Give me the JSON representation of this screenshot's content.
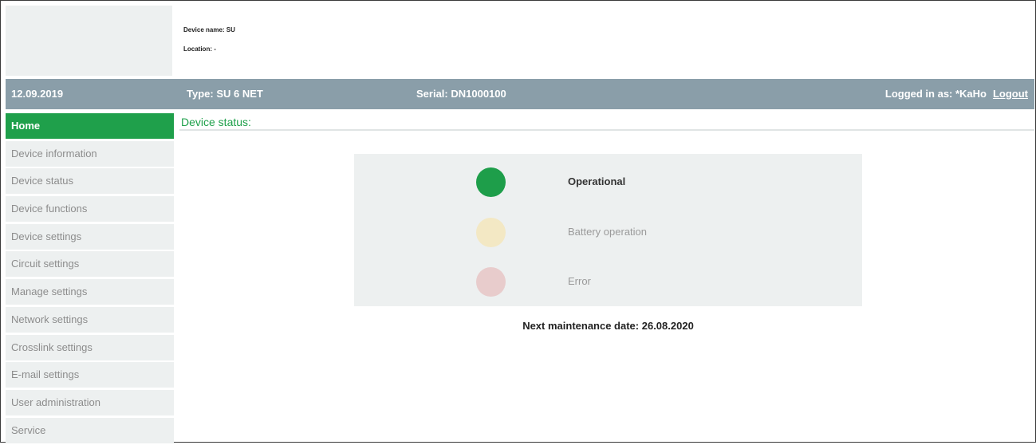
{
  "header": {
    "device_name": "Device name: SU",
    "location": "Location: -"
  },
  "topbar": {
    "date": "12.09.2019",
    "type": "Type: SU 6 NET",
    "serial": "Serial: DN1000100",
    "logged_in": "Logged in as: *KaHo",
    "logout": "Logout"
  },
  "sidebar": {
    "items": [
      {
        "label": "Home",
        "active": true
      },
      {
        "label": "Device information"
      },
      {
        "label": "Device status"
      },
      {
        "label": "Device functions"
      },
      {
        "label": "Device settings"
      },
      {
        "label": "Circuit settings"
      },
      {
        "label": "Manage settings"
      },
      {
        "label": "Network settings"
      },
      {
        "label": "Crosslink settings"
      },
      {
        "label": "E-mail settings"
      },
      {
        "label": "User administration"
      },
      {
        "label": "Service"
      }
    ]
  },
  "main": {
    "title": "Device status:",
    "status": {
      "operational": "Operational",
      "battery": "Battery operation",
      "error": "Error"
    },
    "maintenance": "Next maintenance date: 26.08.2020"
  },
  "colors": {
    "accent": "#1fa04b",
    "topbar": "#8a9ea9",
    "panel": "#edf0f0"
  }
}
